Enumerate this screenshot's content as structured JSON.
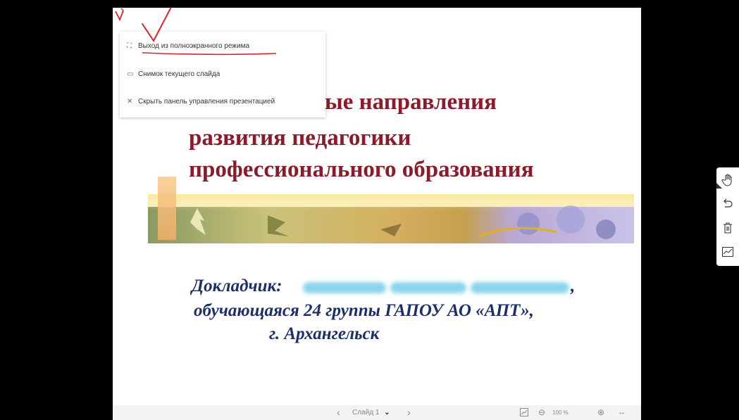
{
  "menu": {
    "items": [
      {
        "icon": "⛶",
        "label": "Выход из полноэкранного режима"
      },
      {
        "icon": "▭",
        "label": "Снимок текущего слайда"
      },
      {
        "icon": "✕",
        "label": "Скрыть панель управления презентацией"
      }
    ]
  },
  "slide": {
    "title": [
      "ые направления",
      "развития педагогики",
      "профессионального образования"
    ],
    "reporter_label": "Докладчик:",
    "reporter_comma": ",",
    "reporter_line2": "обучающаяся 24 группы ГАПОУ АО «АПТ»,",
    "reporter_line3": "г. Архангельск"
  },
  "bottom_bar": {
    "prev": "‹",
    "slide_label": "Слайд 1",
    "dropdown": "⌄",
    "next": "›",
    "zoom_out": "⊖",
    "zoom": "100 %",
    "zoom_in": "⊕",
    "fit": "↔"
  },
  "right_toolbar": {
    "icons": [
      "hand-icon",
      "undo-icon",
      "trash-icon",
      "chart-icon"
    ]
  },
  "colors": {
    "title": "#8b1a2b",
    "reporter": "#1c2f6b",
    "annotation": "#d9262b"
  }
}
